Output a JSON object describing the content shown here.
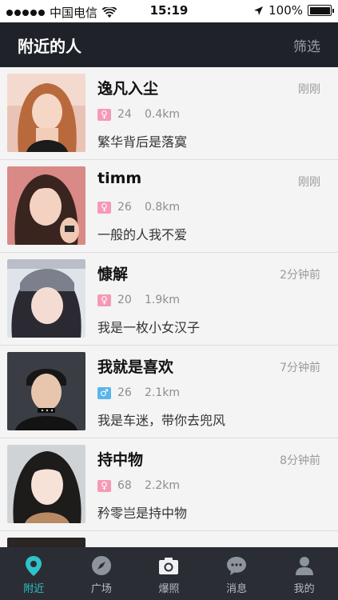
{
  "status_bar": {
    "carrier": "中国电信",
    "time": "15:19",
    "battery": "100%"
  },
  "header": {
    "title": "附近的人",
    "filter_label": "筛选"
  },
  "users": [
    {
      "name": "逸凡入尘",
      "time": "刚刚",
      "gender": "female",
      "gender_symbol": "♀",
      "age": "24",
      "distance": "0.4km",
      "signature": "繁华背后是落寞"
    },
    {
      "name": "timm",
      "time": "刚刚",
      "gender": "female",
      "gender_symbol": "♀",
      "age": "26",
      "distance": "0.8km",
      "signature": "一般的人我不爱"
    },
    {
      "name": "慷解",
      "time": "2分钟前",
      "gender": "female",
      "gender_symbol": "♀",
      "age": "20",
      "distance": "1.9km",
      "signature": "我是一枚小女汉子"
    },
    {
      "name": "我就是喜欢",
      "time": "7分钟前",
      "gender": "male",
      "gender_symbol": "♂",
      "age": "26",
      "distance": "2.1km",
      "signature": "我是车迷，带你去兜风"
    },
    {
      "name": "持中物",
      "time": "8分钟前",
      "gender": "female",
      "gender_symbol": "♀",
      "age": "68",
      "distance": "2.2km",
      "signature": "矜零岂是持中物"
    }
  ],
  "tabs": [
    {
      "label": "附近",
      "icon": "location-pin-icon",
      "active": true
    },
    {
      "label": "广场",
      "icon": "compass-icon",
      "active": false
    },
    {
      "label": "爆照",
      "icon": "camera-icon",
      "active": false
    },
    {
      "label": "消息",
      "icon": "chat-bubble-icon",
      "active": false
    },
    {
      "label": "我的",
      "icon": "person-icon",
      "active": false
    }
  ],
  "colors": {
    "nav_background": "#1f2329",
    "tab_background": "#2a2e34",
    "active_tab": "#2ec3c8",
    "female_badge": "#f59ab6",
    "male_badge": "#5ab5ea"
  }
}
